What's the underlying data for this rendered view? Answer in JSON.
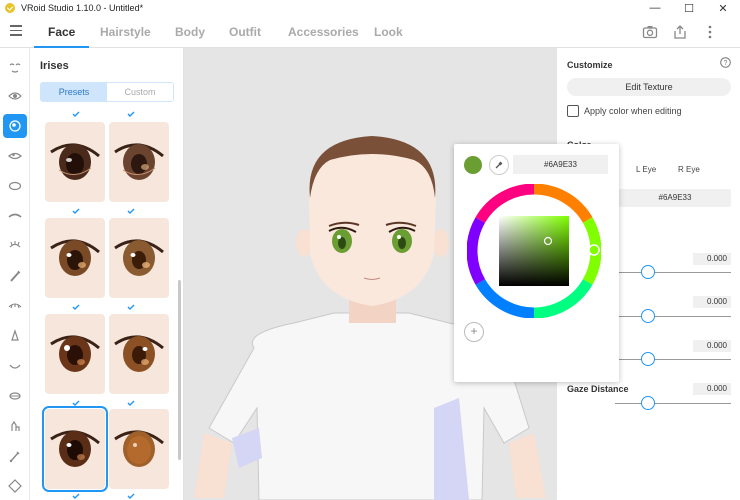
{
  "window": {
    "title": "VRoid Studio 1.10.0 - Untitled*",
    "controls": {
      "minimize": "—",
      "maximize": "☐",
      "close": "✕"
    }
  },
  "tabs": [
    {
      "label": "Face",
      "active": true
    },
    {
      "label": "Hairstyle"
    },
    {
      "label": "Body"
    },
    {
      "label": "Outfit"
    },
    {
      "label": "Accessories"
    },
    {
      "label": "Look"
    }
  ],
  "toolbar_icons": [
    "camera-icon",
    "export-icon",
    "more-vertical-icon"
  ],
  "left_tools": [
    "face-preset-icon",
    "eye-icon",
    "iris-icon",
    "eye-highlight-icon",
    "eye-white-icon",
    "eyebrow-icon",
    "eyelash-icon",
    "eyeliner-icon",
    "eyeshadow-icon",
    "nose-icon",
    "mouth-icon",
    "teeth-icon",
    "ear-icon",
    "face-outline-icon",
    "face-shape-icon"
  ],
  "panel": {
    "title": "Irises",
    "segments": {
      "presets": "Presets",
      "custom": "Custom"
    }
  },
  "right": {
    "customize_title": "Customize",
    "edit_texture": "Edit Texture",
    "apply_color_label": "Apply color when editing",
    "color_title": "Color",
    "eye_tabs": {
      "left": "L Eye",
      "right": "R Eye"
    },
    "hex": "#6A9E33",
    "sliders": [
      {
        "label": "",
        "value": "0.000"
      },
      {
        "label": "",
        "value": "0.000"
      },
      {
        "label": "",
        "value": "0.000"
      },
      {
        "label": "Gaze Distance",
        "value": "0.000"
      }
    ]
  },
  "picker": {
    "hex": "#6A9E33",
    "swatch_color": "#6a9e33",
    "add_label": "+"
  }
}
